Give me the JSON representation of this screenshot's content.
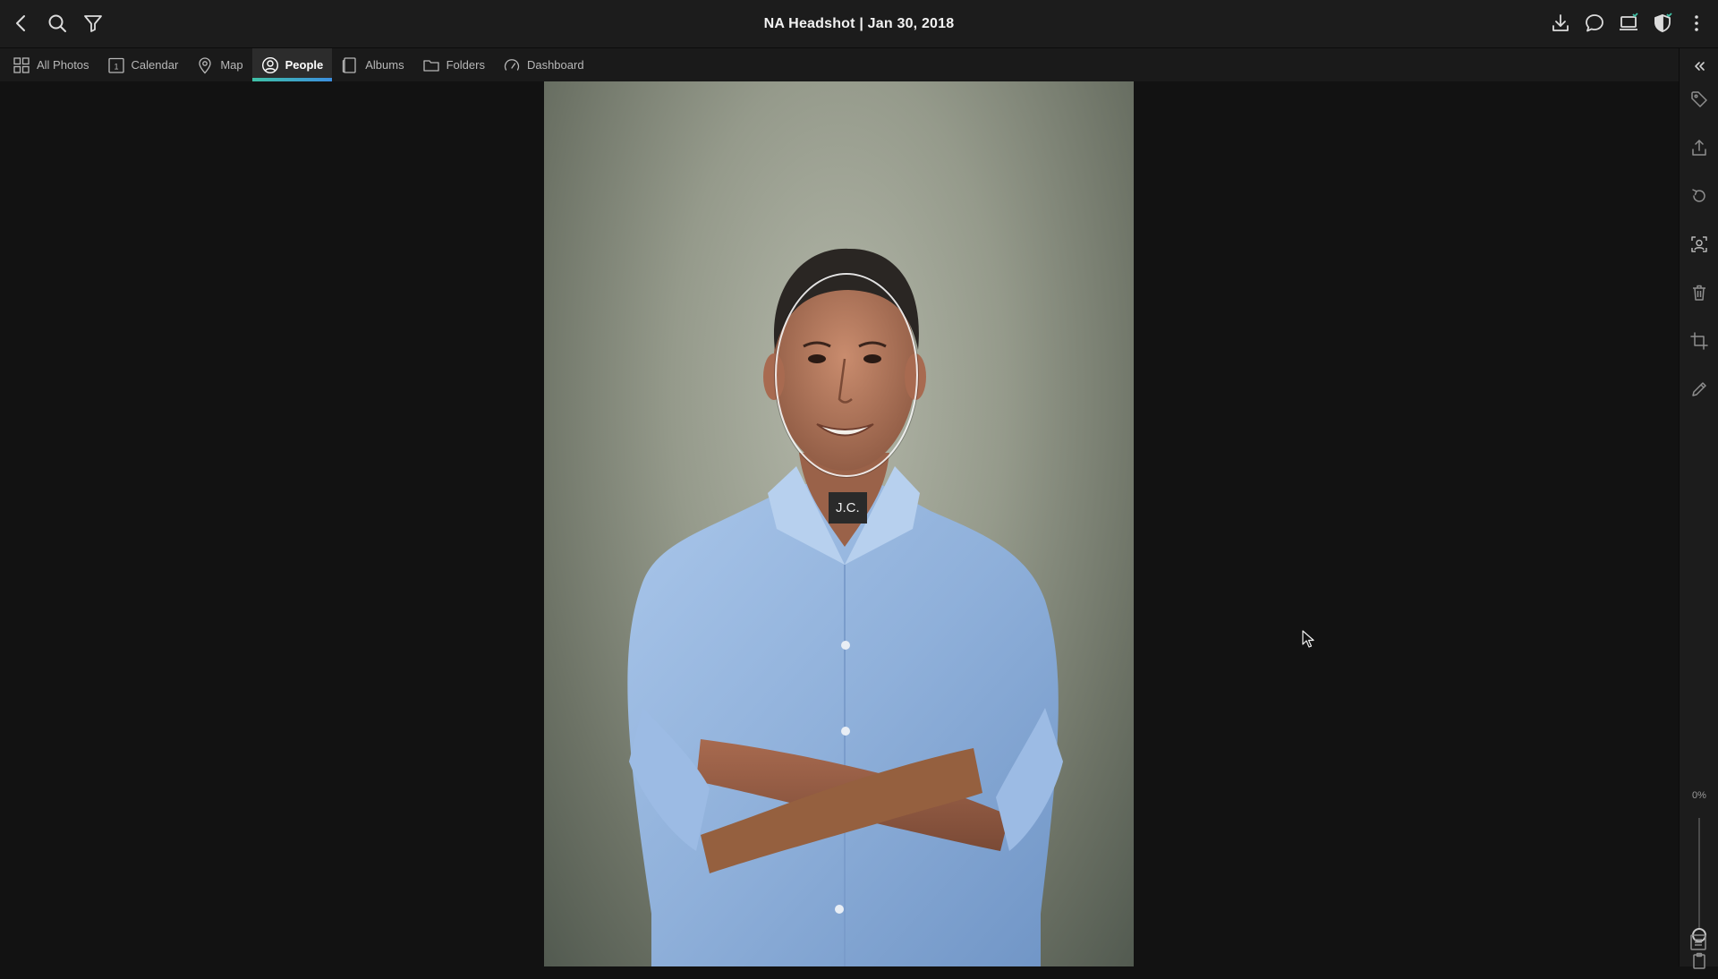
{
  "window": {
    "title": "NA Headshot | Jan 30, 2018"
  },
  "toolbar_left": [
    {
      "name": "back-icon"
    },
    {
      "name": "search-icon"
    },
    {
      "name": "filter-icon"
    }
  ],
  "toolbar_right": [
    {
      "name": "download-icon"
    },
    {
      "name": "comment-icon"
    },
    {
      "name": "device-icon"
    },
    {
      "name": "shield-icon"
    },
    {
      "name": "more-icon"
    }
  ],
  "nav": {
    "tabs": [
      {
        "label": "All Photos",
        "icon": "grid-icon"
      },
      {
        "label": "Calendar",
        "icon": "calendar-icon"
      },
      {
        "label": "Map",
        "icon": "map-pin-icon"
      },
      {
        "label": "People",
        "icon": "person-icon"
      },
      {
        "label": "Albums",
        "icon": "album-icon"
      },
      {
        "label": "Folders",
        "icon": "folder-icon"
      },
      {
        "label": "Dashboard",
        "icon": "dashboard-icon"
      }
    ],
    "active": "People"
  },
  "viewer": {
    "face_tag": "J.C."
  },
  "sidebar": {
    "tools": [
      "collapse-icon",
      "tag-icon",
      "share-icon",
      "rotate-icon",
      "face-icon",
      "trash-icon",
      "crop-icon",
      "edit-icon"
    ],
    "zoom_label": "0%",
    "zoom_level": 0,
    "bottom_tools": [
      "clipboard-icon",
      "list-icon"
    ]
  },
  "colors": {
    "accent_gradient_start": "#3fc1a6",
    "accent_gradient_end": "#3c8fe0",
    "background": "#121212",
    "chrome": "#1c1c1c"
  }
}
